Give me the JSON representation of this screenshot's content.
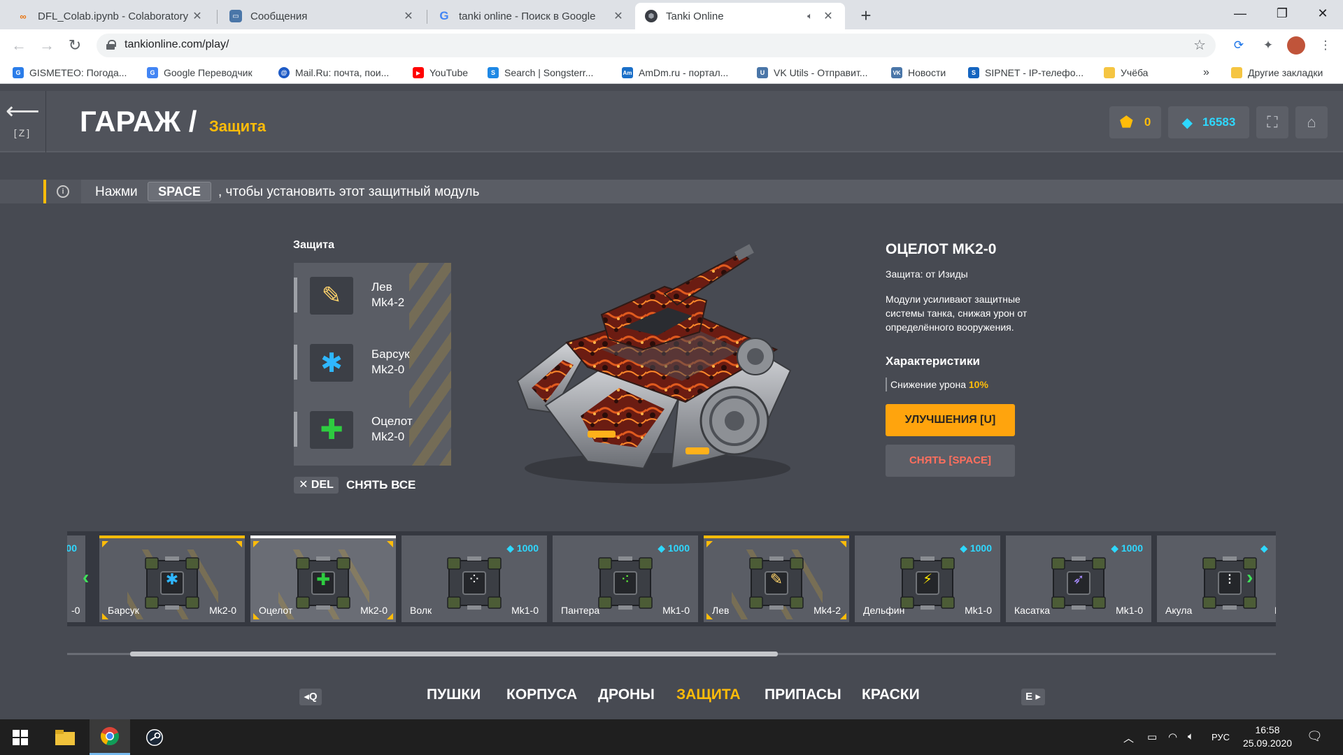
{
  "browser": {
    "tabs": [
      {
        "title": "DFL_Colab.ipynb - Colaboratory",
        "icon": "colab-icon"
      },
      {
        "title": "Сообщения",
        "icon": "vk-messages-icon"
      },
      {
        "title": "tanki online - Поиск в Google",
        "icon": "google-icon"
      },
      {
        "title": "Tanki Online",
        "icon": "tanki-icon",
        "active": true
      }
    ],
    "url": "tankionline.com/play/",
    "bookmarks": [
      {
        "label": "GISMETEO: Погода...",
        "color": "#2b7de9",
        "glyph": "G"
      },
      {
        "label": "Google Переводчик",
        "color": "#4285f4",
        "glyph": "G"
      },
      {
        "label": "Mail.Ru: почта, пои...",
        "color": "#1e5bc6",
        "glyph": "@"
      },
      {
        "label": "YouTube",
        "color": "#ff0000",
        "glyph": "▶"
      },
      {
        "label": "Search | Songsterr...",
        "color": "#1e88e5",
        "glyph": "S"
      },
      {
        "label": "AmDm.ru - портал...",
        "color": "#1a6fc8",
        "glyph": "Am"
      },
      {
        "label": "VK Utils - Отправит...",
        "color": "#4a76a8",
        "glyph": "U"
      },
      {
        "label": "Новости",
        "color": "#4a76a8",
        "glyph": "VK"
      },
      {
        "label": "SIPNET - IP-телефо...",
        "color": "#1565c0",
        "glyph": "S"
      },
      {
        "label": "Учёба",
        "color": "#f5c542",
        "glyph": ""
      }
    ],
    "bookmarks_more": "»",
    "other_bookmarks": "Другие закладки"
  },
  "game": {
    "back_key": "[Z]",
    "title": "ГАРАЖ /",
    "subtitle": "Защита",
    "crystals_gold": "0",
    "crystals": "16583",
    "hint": {
      "before": "Нажми",
      "key": "SPACE",
      "after": ", чтобы установить этот защитный модуль"
    },
    "protection_label": "Защита",
    "equipped": [
      {
        "name": "Лев",
        "level": "Mk4-2",
        "icon": "lion-module-icon",
        "color": "#ffd36b"
      },
      {
        "name": "Барсук",
        "level": "Mk2-0",
        "icon": "badger-module-icon",
        "color": "#2fb7ff"
      },
      {
        "name": "Оцелот",
        "level": "Mk2-0",
        "icon": "ocelot-module-icon",
        "color": "#2ecc40"
      }
    ],
    "del_key": "✕ DEL",
    "remove_all": "СНЯТЬ ВСЕ",
    "item": {
      "title": "ОЦЕЛОТ MK2-0",
      "protection": "Защита: от Изиды",
      "description": "Модули усиливают защитные системы танка, снижая урон от определённого вооружения.",
      "characteristics": "Характеристики",
      "stat_label": "Снижение урона",
      "stat_value": "10%",
      "upgrade_button": "УЛУЧШЕНИЯ [U]",
      "remove_button": "СНЯТЬ [SPACE]"
    },
    "cards": [
      {
        "name": "",
        "level": "-0",
        "price": "00",
        "state": "partial-left"
      },
      {
        "name": "Барсук",
        "level": "Mk2-0",
        "price": "",
        "state": "equipped",
        "glyph": "✱",
        "glyph_color": "#2fb7ff"
      },
      {
        "name": "Оцелот",
        "level": "Mk2-0",
        "price": "",
        "state": "selected",
        "glyph": "✚",
        "glyph_color": "#2ecc40"
      },
      {
        "name": "Волк",
        "level": "Mk1-0",
        "price": "1000",
        "state": "shop",
        "glyph": "⁘",
        "glyph_color": "#e8e8e8"
      },
      {
        "name": "Пантера",
        "level": "Mk1-0",
        "price": "1000",
        "state": "shop",
        "glyph": "⁖",
        "glyph_color": "#63ff3a"
      },
      {
        "name": "Лев",
        "level": "Mk4-2",
        "price": "",
        "state": "equipped",
        "glyph": "✎",
        "glyph_color": "#ffd36b"
      },
      {
        "name": "Дельфин",
        "level": "Mk1-0",
        "price": "1000",
        "state": "shop",
        "glyph": "⚡",
        "glyph_color": "#ffe600"
      },
      {
        "name": "Касатка",
        "level": "Mk1-0",
        "price": "1000",
        "state": "shop",
        "glyph": "➶",
        "glyph_color": "#a78bff"
      },
      {
        "name": "Акула",
        "level": "M",
        "price": "",
        "state": "partial-right",
        "glyph": "⁝",
        "glyph_color": "#e8e8e8"
      }
    ],
    "nav": {
      "q_key": "◂Q",
      "e_key": "E ▸",
      "tabs": [
        {
          "label": "ПУШКИ",
          "active": false
        },
        {
          "label": "КОРПУСА",
          "active": false
        },
        {
          "label": "ДРОНЫ",
          "active": false
        },
        {
          "label": "ЗАЩИТА",
          "active": true
        },
        {
          "label": "ПРИПАСЫ",
          "active": false
        },
        {
          "label": "КРАСКИ",
          "active": false
        }
      ]
    }
  },
  "taskbar": {
    "lang": "РУС",
    "time": "16:58",
    "date": "25.09.2020"
  }
}
